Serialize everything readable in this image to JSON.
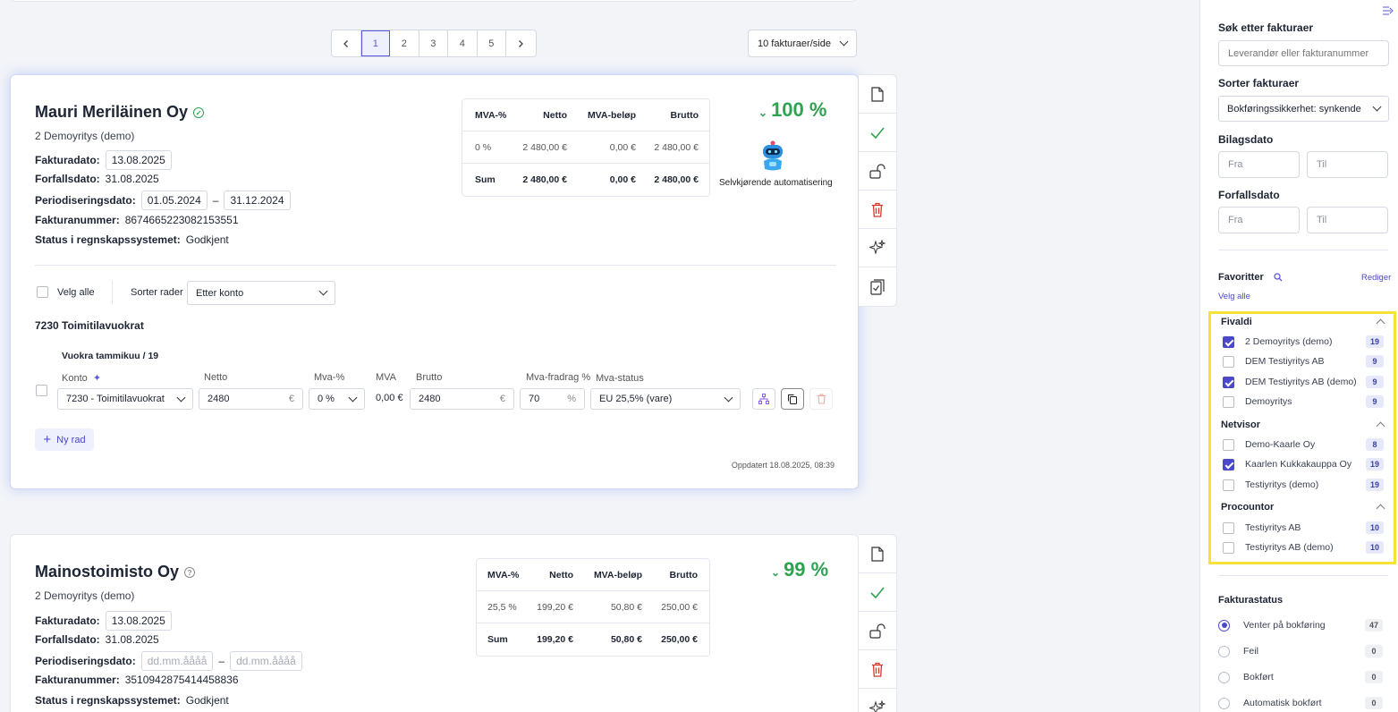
{
  "pagination": {
    "pages": [
      "1",
      "2",
      "3",
      "4",
      "5"
    ],
    "active": "1",
    "per_page": "10 fakturaer/side"
  },
  "labels": {
    "invoice_date": "Fakturadato:",
    "due_date": "Forfallsdato:",
    "period_date": "Periodiseringsdato:",
    "invoice_number": "Fakturanummer:",
    "status_accounting": "Status i regnskapssystemet:",
    "dash": "–"
  },
  "vat_headers": [
    "MVA-%",
    "Netto",
    "MVA-beløp",
    "Brutto"
  ],
  "invoices": [
    {
      "vendor": "Mauri Meriläinen Oy",
      "company": "2 Demoyritys (demo)",
      "invoice_date": "13.08.2025",
      "due_date": "31.08.2025",
      "period_from": "01.05.2024",
      "period_to": "31.12.2024",
      "invoice_number": "8674665223082153551",
      "status": "Godkjent",
      "vat_row": [
        "0 %",
        "2 480,00 €",
        "0,00 €",
        "2 480,00 €"
      ],
      "sum_row": [
        "Sum",
        "2 480,00 €",
        "0,00 €",
        "2 480,00 €"
      ],
      "confidence": "100 %",
      "automation_label": "Selvkjørende automatisering",
      "select_all": "Velg alle",
      "sort_rows_label": "Sorter rader",
      "sort_rows_value": "Etter konto",
      "account_group": "7230 Toimitilavuokrat",
      "line_title": "Vuokra tammikuu / 19",
      "col_headers": {
        "konto": "Konto",
        "netto": "Netto",
        "mva_pct": "Mva-%",
        "mva": "MVA",
        "brutto": "Brutto",
        "deduction": "Mva-fradrag %",
        "mva_status": "Mva-status"
      },
      "line": {
        "konto": "7230 - Toimitilavuokrat",
        "netto": "2480",
        "netto_unit": "€",
        "mva_pct": "0 %",
        "mva": "0,00 €",
        "brutto": "2480",
        "brutto_unit": "€",
        "deduction": "70",
        "deduction_unit": "%",
        "mva_status": "EU 25,5% (vare)"
      },
      "new_row": "Ny rad",
      "updated": "Oppdatert 18.08.2025, 08:39"
    },
    {
      "vendor": "Mainostoimisto Oy",
      "company": "2 Demoyritys (demo)",
      "invoice_date": "13.08.2025",
      "due_date": "31.08.2025",
      "period_from_placeholder": "dd.mm.åååå",
      "period_to_placeholder": "dd.mm.åååå",
      "invoice_number": "3510942875414458836",
      "status": "Godkjent",
      "vat_row": [
        "25,5 %",
        "199,20 €",
        "50,80 €",
        "250,00 €"
      ],
      "sum_row": [
        "Sum",
        "199,20 €",
        "50,80 €",
        "250,00 €"
      ],
      "confidence": "99 %"
    }
  ],
  "sidebar": {
    "search_title": "Søk etter fakturaer",
    "search_placeholder": "Leverandør eller fakturanummer",
    "sort_title": "Sorter fakturaer",
    "sort_value": "Bokføringssikkerhet: synkende",
    "voucher_date_title": "Bilagsdato",
    "due_date_title": "Forfallsdato",
    "from_placeholder": "Fra",
    "to_placeholder": "Til",
    "favorites_title": "Favoritter",
    "edit_link": "Rediger",
    "select_all_link": "Velg alle",
    "groups": [
      {
        "name": "Fivaldi",
        "items": [
          {
            "label": "2 Demoyritys (demo)",
            "count": "19",
            "checked": true
          },
          {
            "label": "DEM Testiyritys AB",
            "count": "9",
            "checked": false
          },
          {
            "label": "DEM Testiyritys AB (demo)",
            "count": "9",
            "checked": true
          },
          {
            "label": "Demoyritys",
            "count": "9",
            "checked": false
          }
        ]
      },
      {
        "name": "Netvisor",
        "items": [
          {
            "label": "Demo-Kaarle Oy",
            "count": "8",
            "checked": false
          },
          {
            "label": "Kaarlen Kukkakauppa Oy",
            "count": "19",
            "checked": true
          },
          {
            "label": "Testiyritys (demo)",
            "count": "19",
            "checked": false
          }
        ]
      },
      {
        "name": "Procountor",
        "items": [
          {
            "label": "Testiyritys AB",
            "count": "10",
            "checked": false
          },
          {
            "label": "Testiyritys AB (demo)",
            "count": "10",
            "checked": false
          }
        ]
      }
    ],
    "status_title": "Fakturastatus",
    "statuses": [
      {
        "label": "Venter på bokføring",
        "count": "47",
        "selected": true
      },
      {
        "label": "Feil",
        "count": "0",
        "selected": false
      },
      {
        "label": "Bokført",
        "count": "0",
        "selected": false
      },
      {
        "label": "Automatisk bokført",
        "count": "0",
        "selected": false
      }
    ]
  },
  "colors": {
    "accent": "#4b49c9",
    "success": "#2ea352",
    "danger": "#d9342b",
    "highlight": "#f5e33a"
  }
}
